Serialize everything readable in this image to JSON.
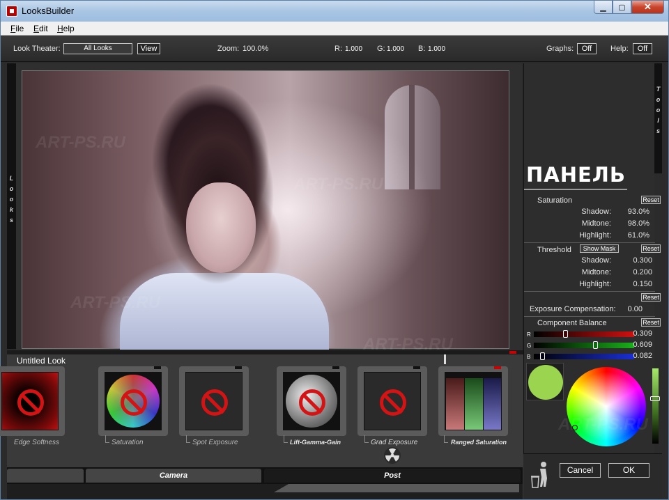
{
  "window": {
    "title": "LooksBuilder"
  },
  "menu": [
    "File",
    "Edit",
    "Help"
  ],
  "toolbar": {
    "look_theater_label": "Look Theater:",
    "look_theater_value": "All Looks",
    "view_button": "View",
    "zoom_label": "Zoom:",
    "zoom_value": "100.0%",
    "r_label": "R:",
    "r_value": "1.000",
    "g_label": "G:",
    "g_value": "1.000",
    "b_label": "B:",
    "b_value": "1.000",
    "graphs_label": "Graphs:",
    "graphs_value": "Off",
    "help_label": "Help:",
    "help_value": "Off"
  },
  "left_strip": [
    "L",
    "o",
    "o",
    "k",
    "s"
  ],
  "right_strip": [
    "T",
    "o",
    "o",
    "l",
    "s"
  ],
  "panel": {
    "logo": "ПАНЕЛЬ",
    "saturation": {
      "title": "Saturation",
      "reset": "Reset",
      "rows": [
        {
          "label": "Shadow:",
          "value": "93.0%"
        },
        {
          "label": "Midtone:",
          "value": "98.0%"
        },
        {
          "label": "Highlight:",
          "value": "61.0%"
        }
      ]
    },
    "threshold": {
      "title": "Threshold",
      "show_mask": "Show Mask",
      "reset": "Reset",
      "rows": [
        {
          "label": "Shadow:",
          "value": "0.300"
        },
        {
          "label": "Midtone:",
          "value": "0.200"
        },
        {
          "label": "Highlight:",
          "value": "0.150"
        }
      ]
    },
    "exposure": {
      "reset": "Reset",
      "label": "Exposure Compensation:",
      "value": "0.00"
    },
    "component_balance": {
      "title": "Component Balance",
      "reset": "Reset",
      "channels": [
        {
          "letter": "R",
          "value": "0.309",
          "level": 0.31,
          "color": "#d01010"
        },
        {
          "letter": "G",
          "value": "0.609",
          "level": 0.61,
          "color": "#19b019"
        },
        {
          "letter": "B",
          "value": "0.082",
          "level": 0.08,
          "color": "#1a2fd6"
        }
      ]
    },
    "swatch_color": "#9bd44f",
    "cancel": "Cancel",
    "ok": "OK"
  },
  "look": {
    "title": "Untitled Look",
    "tools": [
      {
        "label": "Edge Softness",
        "icon": "disabled-icon"
      },
      {
        "label": "Saturation",
        "icon": "disabled-icon"
      },
      {
        "label": "Spot Exposure",
        "icon": "disabled-icon"
      },
      {
        "label": "Lift-Gamma-Gain",
        "icon": "disabled-icon"
      },
      {
        "label": "Grad Exposure",
        "icon": "disabled-icon"
      },
      {
        "label": "Ranged Saturation",
        "icon": "rgb-bars-icon"
      }
    ]
  },
  "tabs": {
    "first": "",
    "camera": "Camera",
    "post": "Post"
  },
  "watermark": "ART-PS.RU"
}
